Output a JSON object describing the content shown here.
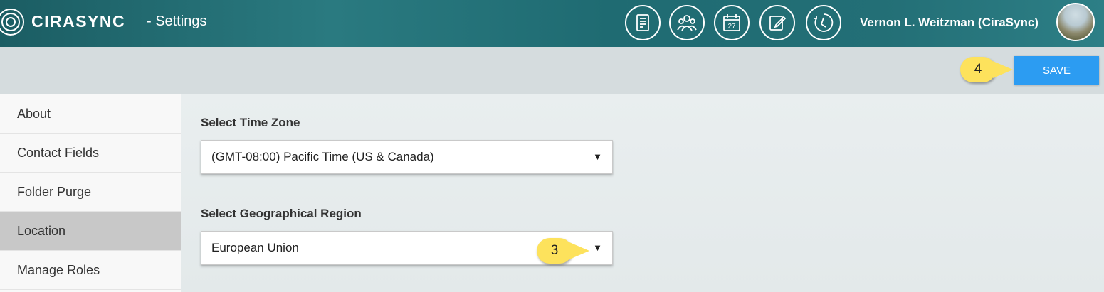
{
  "header": {
    "brand": "CIRASYNC",
    "subtitle": "- Settings",
    "icons": [
      "contacts-list-icon",
      "people-icon",
      "calendar-icon",
      "edit-icon",
      "clock-icon"
    ],
    "calendar_day": "27",
    "user_name": "Vernon L. Weitzman (CiraSync)"
  },
  "toolbar": {
    "save_label": "SAVE",
    "callout_save": "4"
  },
  "sidebar": {
    "items": [
      {
        "label": "About"
      },
      {
        "label": "Contact Fields"
      },
      {
        "label": "Folder Purge"
      },
      {
        "label": "Location"
      },
      {
        "label": "Manage Roles"
      }
    ],
    "active_item": "Location"
  },
  "main": {
    "timezone_label": "Select Time Zone",
    "timezone_value": "(GMT-08:00) Pacific Time (US & Canada)",
    "region_label": "Select Geographical Region",
    "region_value": "European Union",
    "callout_region": "3"
  },
  "colors": {
    "header": "#1f6b72",
    "save_button": "#2c9cf2",
    "callout": "#fde25c",
    "active_sidebar": "#c8c8c8"
  }
}
